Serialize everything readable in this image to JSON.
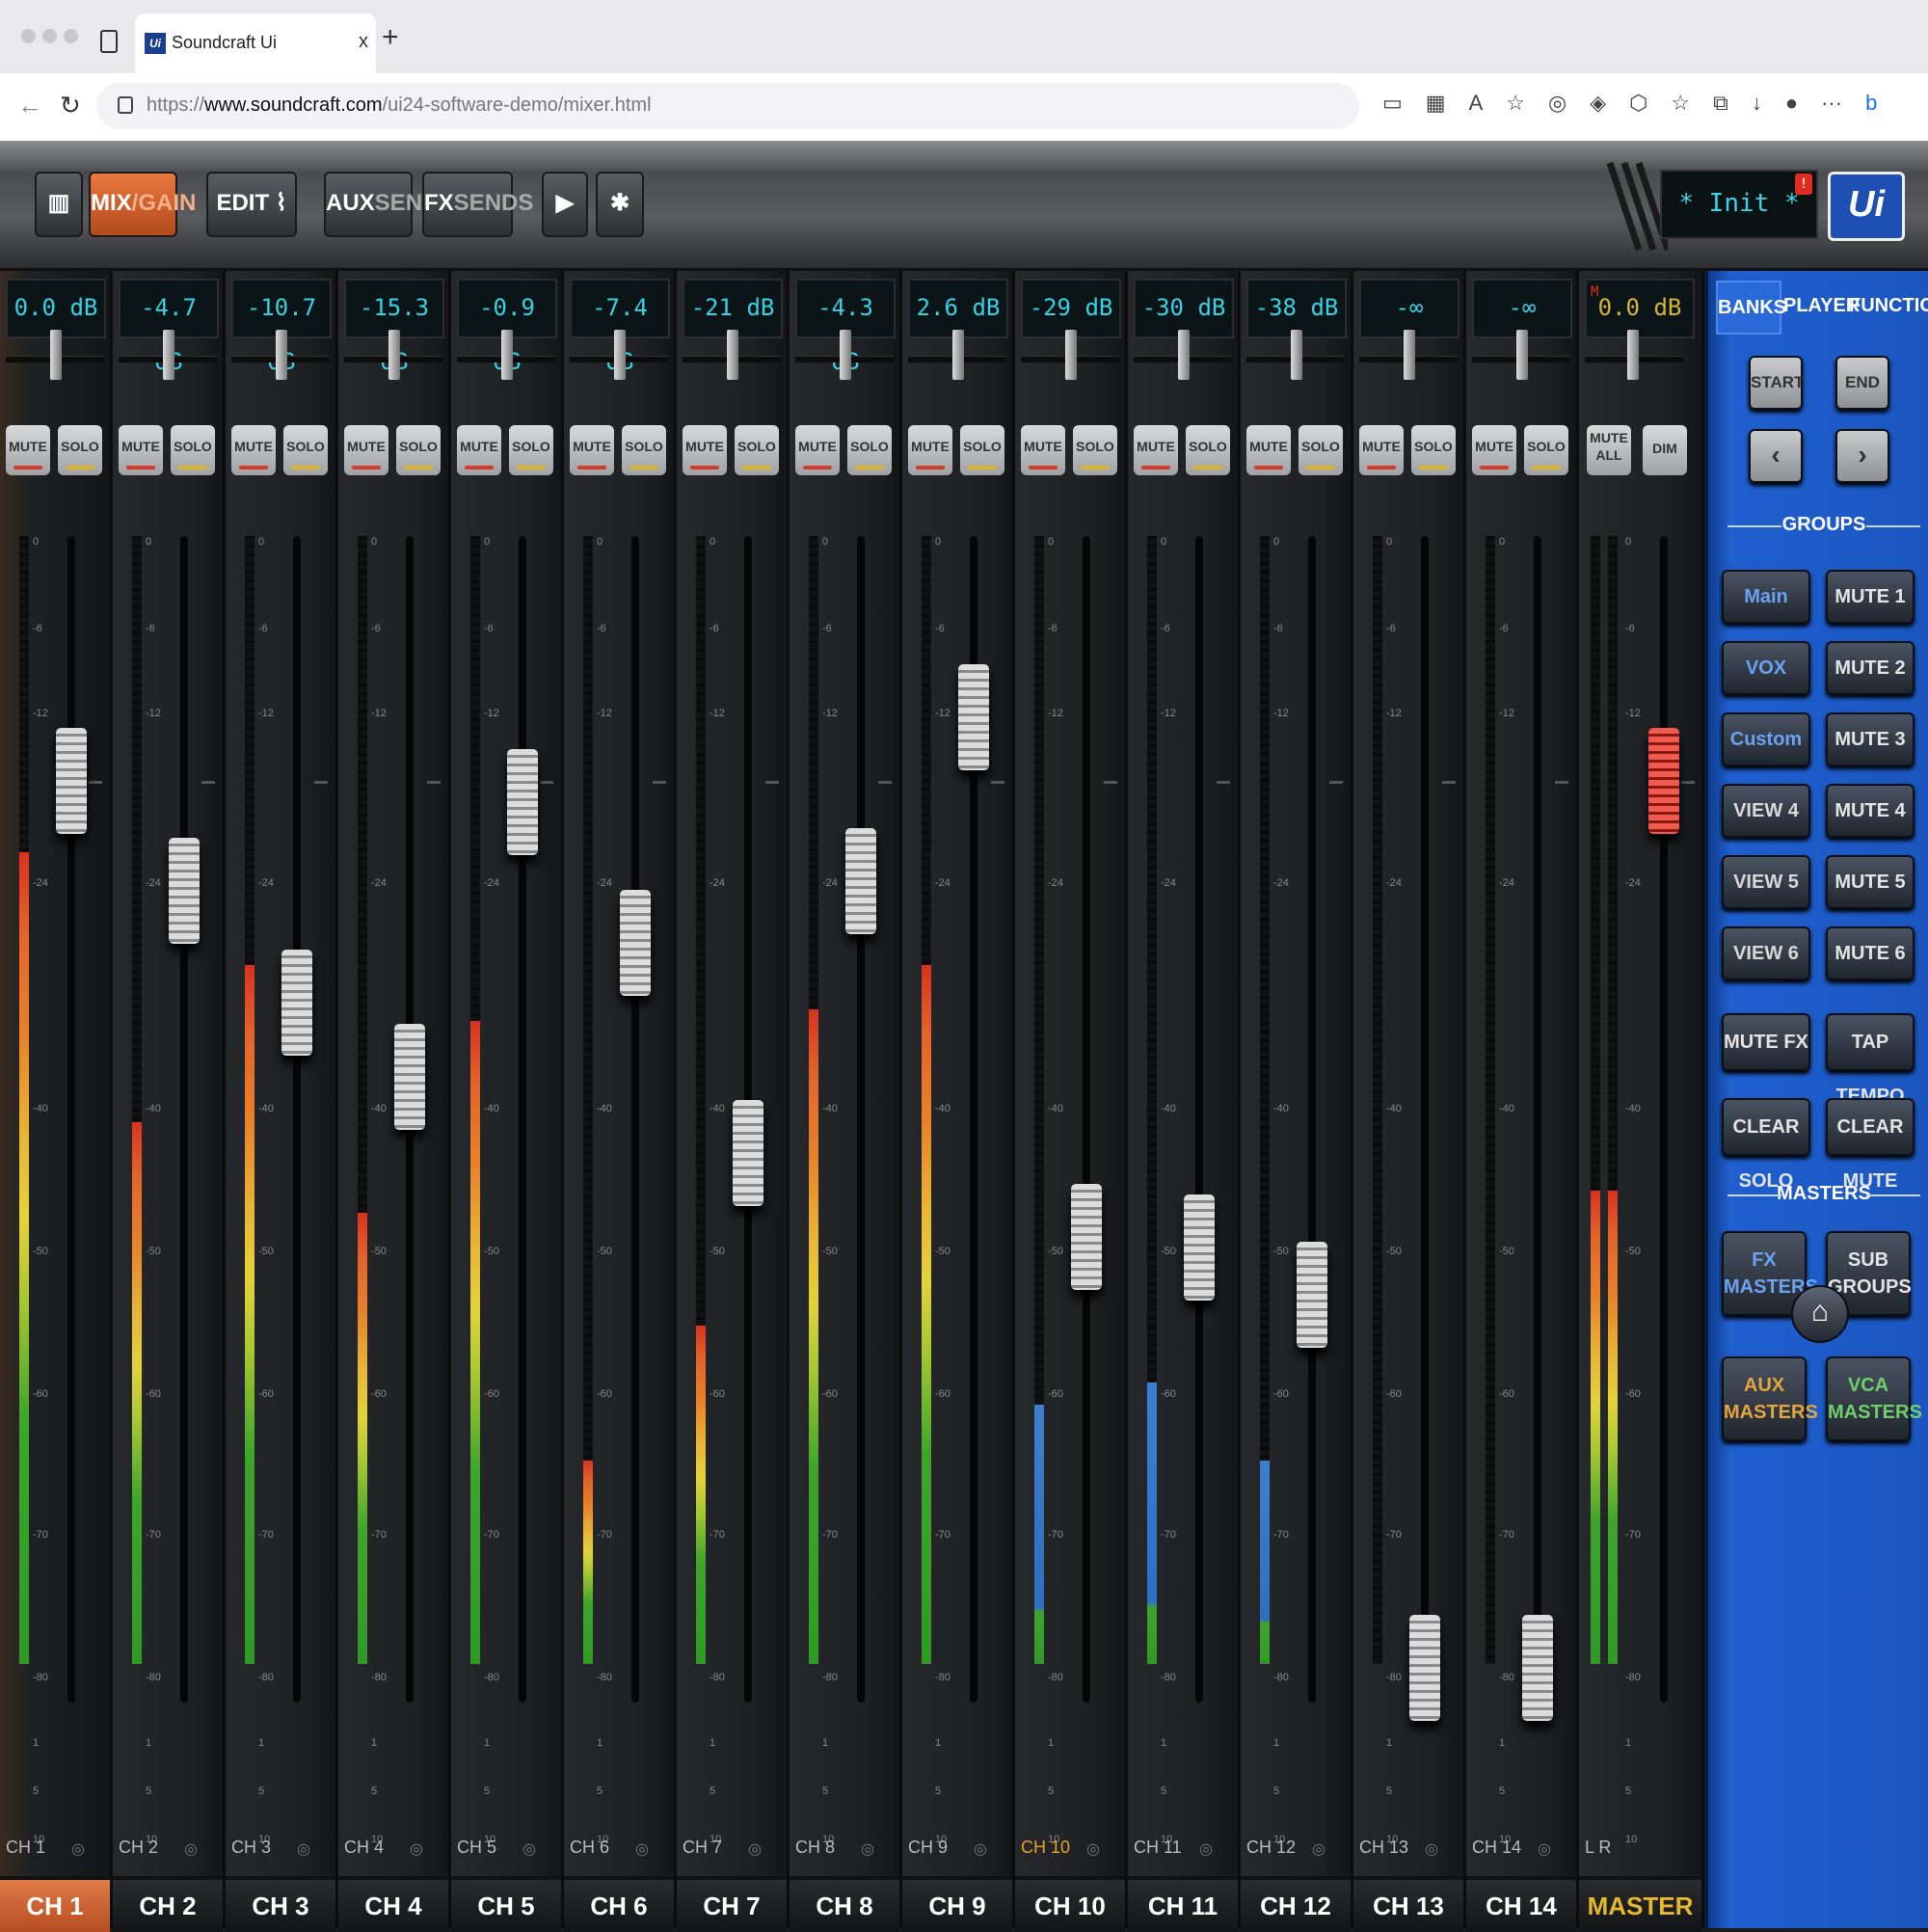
{
  "browser": {
    "tab_title": "Soundcraft Ui",
    "favicon_text": "Ui",
    "url_prefix": "https://",
    "url_host": "www.soundcraft.com",
    "url_path": "/ui24-software-demo/mixer.html"
  },
  "toolbar": {
    "mix_label": "MIX",
    "gain_label": "/GAIN",
    "edit_label": "EDIT",
    "aux_label": "AUX",
    "aux_sends_label": "SENDS",
    "fx_label": "FX",
    "fx_sends_label": "SENDS",
    "scene_name": "* Init *",
    "scene_warning": "!",
    "logo": "Ui"
  },
  "channels": [
    {
      "name": "CH 1",
      "label": "CH 1",
      "db": "0.0 dB",
      "fader": 0.0,
      "meter": 0.72,
      "selected": true
    },
    {
      "name": "CH 2",
      "label": "CH 2",
      "db": "-4.7 dB",
      "fader": -4.7,
      "meter": 0.48
    },
    {
      "name": "CH 3",
      "label": "CH 3",
      "db": "-10.7 dB",
      "fader": -10.7,
      "meter": 0.62
    },
    {
      "name": "CH 4",
      "label": "CH 4",
      "db": "-15.3 dB",
      "fader": -15.3,
      "meter": 0.4
    },
    {
      "name": "CH 5",
      "label": "CH 5",
      "db": "-0.9 dB",
      "fader": -0.9,
      "meter": 0.57
    },
    {
      "name": "CH 6",
      "label": "CH 6",
      "db": "-7.4 dB",
      "fader": -7.4,
      "meter": 0.18
    },
    {
      "name": "CH 7",
      "label": "CH 7",
      "db": "-21 dB",
      "fader": -21,
      "meter": 0.3
    },
    {
      "name": "CH 8",
      "label": "CH 8",
      "db": "-4.3 dB",
      "fader": -4.3,
      "meter": 0.58
    },
    {
      "name": "CH 9",
      "label": "CH 9",
      "db": "2.6 dB",
      "fader": 2.6,
      "meter": 0.62
    },
    {
      "name": "CH 10",
      "label": "CH 10",
      "db": "-29 dB",
      "fader": -29,
      "meter": 0.23,
      "yellow_name": true
    },
    {
      "name": "CH 11",
      "label": "CH 11",
      "db": "-30 dB",
      "fader": -30,
      "meter": 0.25
    },
    {
      "name": "CH 12",
      "label": "CH 12",
      "db": "-38 dB",
      "fader": -38,
      "meter": 0.18
    },
    {
      "name": "CH 13",
      "label": "CH 13",
      "db": "-∞",
      "fader": -100,
      "meter": 0.0
    },
    {
      "name": "CH 14",
      "label": "CH 14",
      "db": "-∞",
      "fader": -100,
      "meter": 0.0
    }
  ],
  "master": {
    "name": "L  R",
    "label": "MASTER",
    "db": "0.0 dB",
    "marker": "M",
    "fader": 0.0,
    "meter": 0.42
  },
  "strip_buttons": {
    "mute": "MUTE",
    "solo": "SOLO",
    "mute_all": "MUTE ALL",
    "dim": "DIM"
  },
  "scale": [
    "0",
    "-6",
    "-12",
    "-24",
    "-40",
    "-50",
    "-60",
    "-70",
    "-80",
    "1",
    "5",
    "10",
    "20"
  ],
  "panel": {
    "tabs": [
      "BANKS",
      "PLAYER",
      "FUNCTIONS"
    ],
    "start": "START",
    "end": "END",
    "prev": "‹",
    "next": "›",
    "groups_title": "GROUPS",
    "groups": [
      {
        "view": "Main",
        "mute": "MUTE 1"
      },
      {
        "view": "VOX",
        "mute": "MUTE 2"
      },
      {
        "view": "Custom",
        "mute": "MUTE 3"
      },
      {
        "view": "VIEW 4",
        "mute": "MUTE 4"
      },
      {
        "view": "VIEW 5",
        "mute": "MUTE 5"
      },
      {
        "view": "VIEW 6",
        "mute": "MUTE 6"
      }
    ],
    "mute_fx": "MUTE FX",
    "tap_tempo": "TAP TEMPO",
    "clear_solo": "CLEAR SOLO",
    "clear_mute": "CLEAR MUTE",
    "masters_title": "MASTERS",
    "fx_masters_1": "FX",
    "fx_masters_2": "MASTERS",
    "sub_groups_1": "SUB",
    "sub_groups_2": "GROUPS",
    "aux_masters_1": "AUX",
    "aux_masters_2": "MASTERS",
    "vca_masters_1": "VCA",
    "vca_masters_2": "MASTERS"
  },
  "colors": {
    "accent": "#d9622b",
    "meter_blue": "#3d7fcf",
    "meter_green": "#3da52a",
    "meter_yellow": "#e4d23a",
    "meter_orange": "#e8802a",
    "meter_red": "#d9321f"
  }
}
